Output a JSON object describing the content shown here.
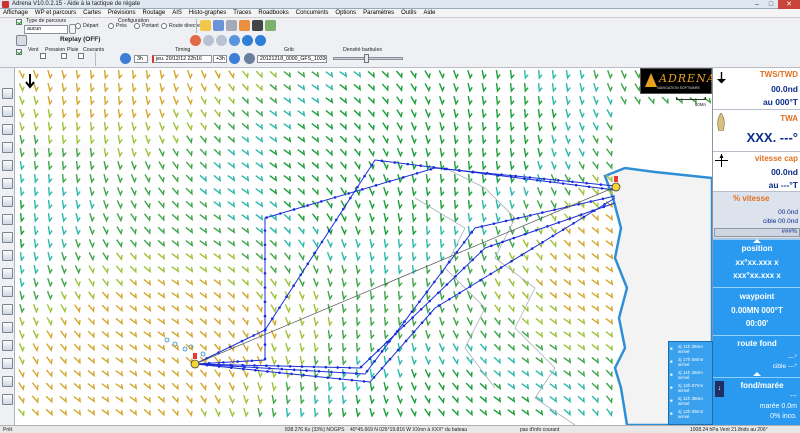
{
  "window": {
    "title": "Adrena V10.0.2.15 - Aide à la tactique de régate"
  },
  "menu": [
    "Affichage",
    "WP et parcours",
    "Cartes",
    "Prévisions",
    "Routage",
    "AIS",
    "Histo-graphes",
    "Traces",
    "Roadbooks",
    "Concurrents",
    "Options",
    "Paramètres",
    "Outils",
    "Aide"
  ],
  "toolbar": {
    "type_parcours_label": "Type de parcours",
    "type_parcours_value": "aucun",
    "configuration_label": "Configuration",
    "config_depart": "Départ",
    "config_pres": "Près",
    "config_portant": "Portant",
    "config_route_directe": "Route directe",
    "replay_label": "Replay (OFF)",
    "layers": [
      "Vent",
      "Pression",
      "Pluie",
      "Courants"
    ],
    "timing_label": "Timing",
    "grib_label": "Grib",
    "densite_label": "Densité barbules",
    "step_value": "3h",
    "time_value": "jeu. 20/12/12 22h16",
    "offset_value": "+3h",
    "grib_file": "20121218_0000_GFS_103308"
  },
  "logo": {
    "name": "ADRENA",
    "tagline": "NAVIGATION SOFTWARE",
    "scale": "50Mn"
  },
  "panel": {
    "tws_title": "TWS/TWD",
    "tws_value": "00.0nd",
    "twd_value": "au 000°T",
    "twa_title": "TWA",
    "twa_value": "XXX. ---°",
    "vcap_title": "vitesse cap",
    "vcap_value": "00.0nd",
    "vcap_heading": "au ---°T",
    "pct_title": "% vitesse",
    "pct_value": "00.0nd",
    "pct_cible": "cible 00.0nd",
    "pct_percent": "###%",
    "position_title": "position",
    "lat": "xx°xx.xxx x",
    "lon": "xxx°xx.xxx x",
    "waypoint_title": "waypoint",
    "wp_value": "0.00MN 000°T",
    "wp_time": "00:00'",
    "route_fond_title": "route fond",
    "rf_value": "---°",
    "rf_cible": "cible ---°",
    "fond_title": "fond/marée",
    "fond_value": "---",
    "maree_value": "marée 0.0m",
    "incert_value": "0% inco."
  },
  "tide": [
    {
      "time": "2j 11h 36mn",
      "status": "arrivé"
    },
    {
      "time": "2j 17h 58mn",
      "status": "arrivé"
    },
    {
      "time": "2j 11h 26mn",
      "status": "arrivé"
    },
    {
      "time": "2j 12h 07mn",
      "status": "arrivé"
    },
    {
      "time": "2j 11h 38mn",
      "status": "arrivé"
    },
    {
      "time": "2j 12h 05mn",
      "status": "arrivé"
    }
  ],
  "status": {
    "left": "Prêt",
    "center": "838.276 Kx (33%) NOGPS",
    "coords": "40°45.669 N 026°19.816 W XXmn à XXX° du bateau",
    "info": "pas d'info courant",
    "right": "1008.24 hPa Vent 21.8nds au 206°"
  },
  "colors": {
    "accent_blue": "#2a9af0",
    "value_blue": "#0b2d8c",
    "header_orange": "#e07020",
    "route_blue": "#1a2ed8",
    "land": "#f3f3f3",
    "coast": "#2f8fd6"
  }
}
